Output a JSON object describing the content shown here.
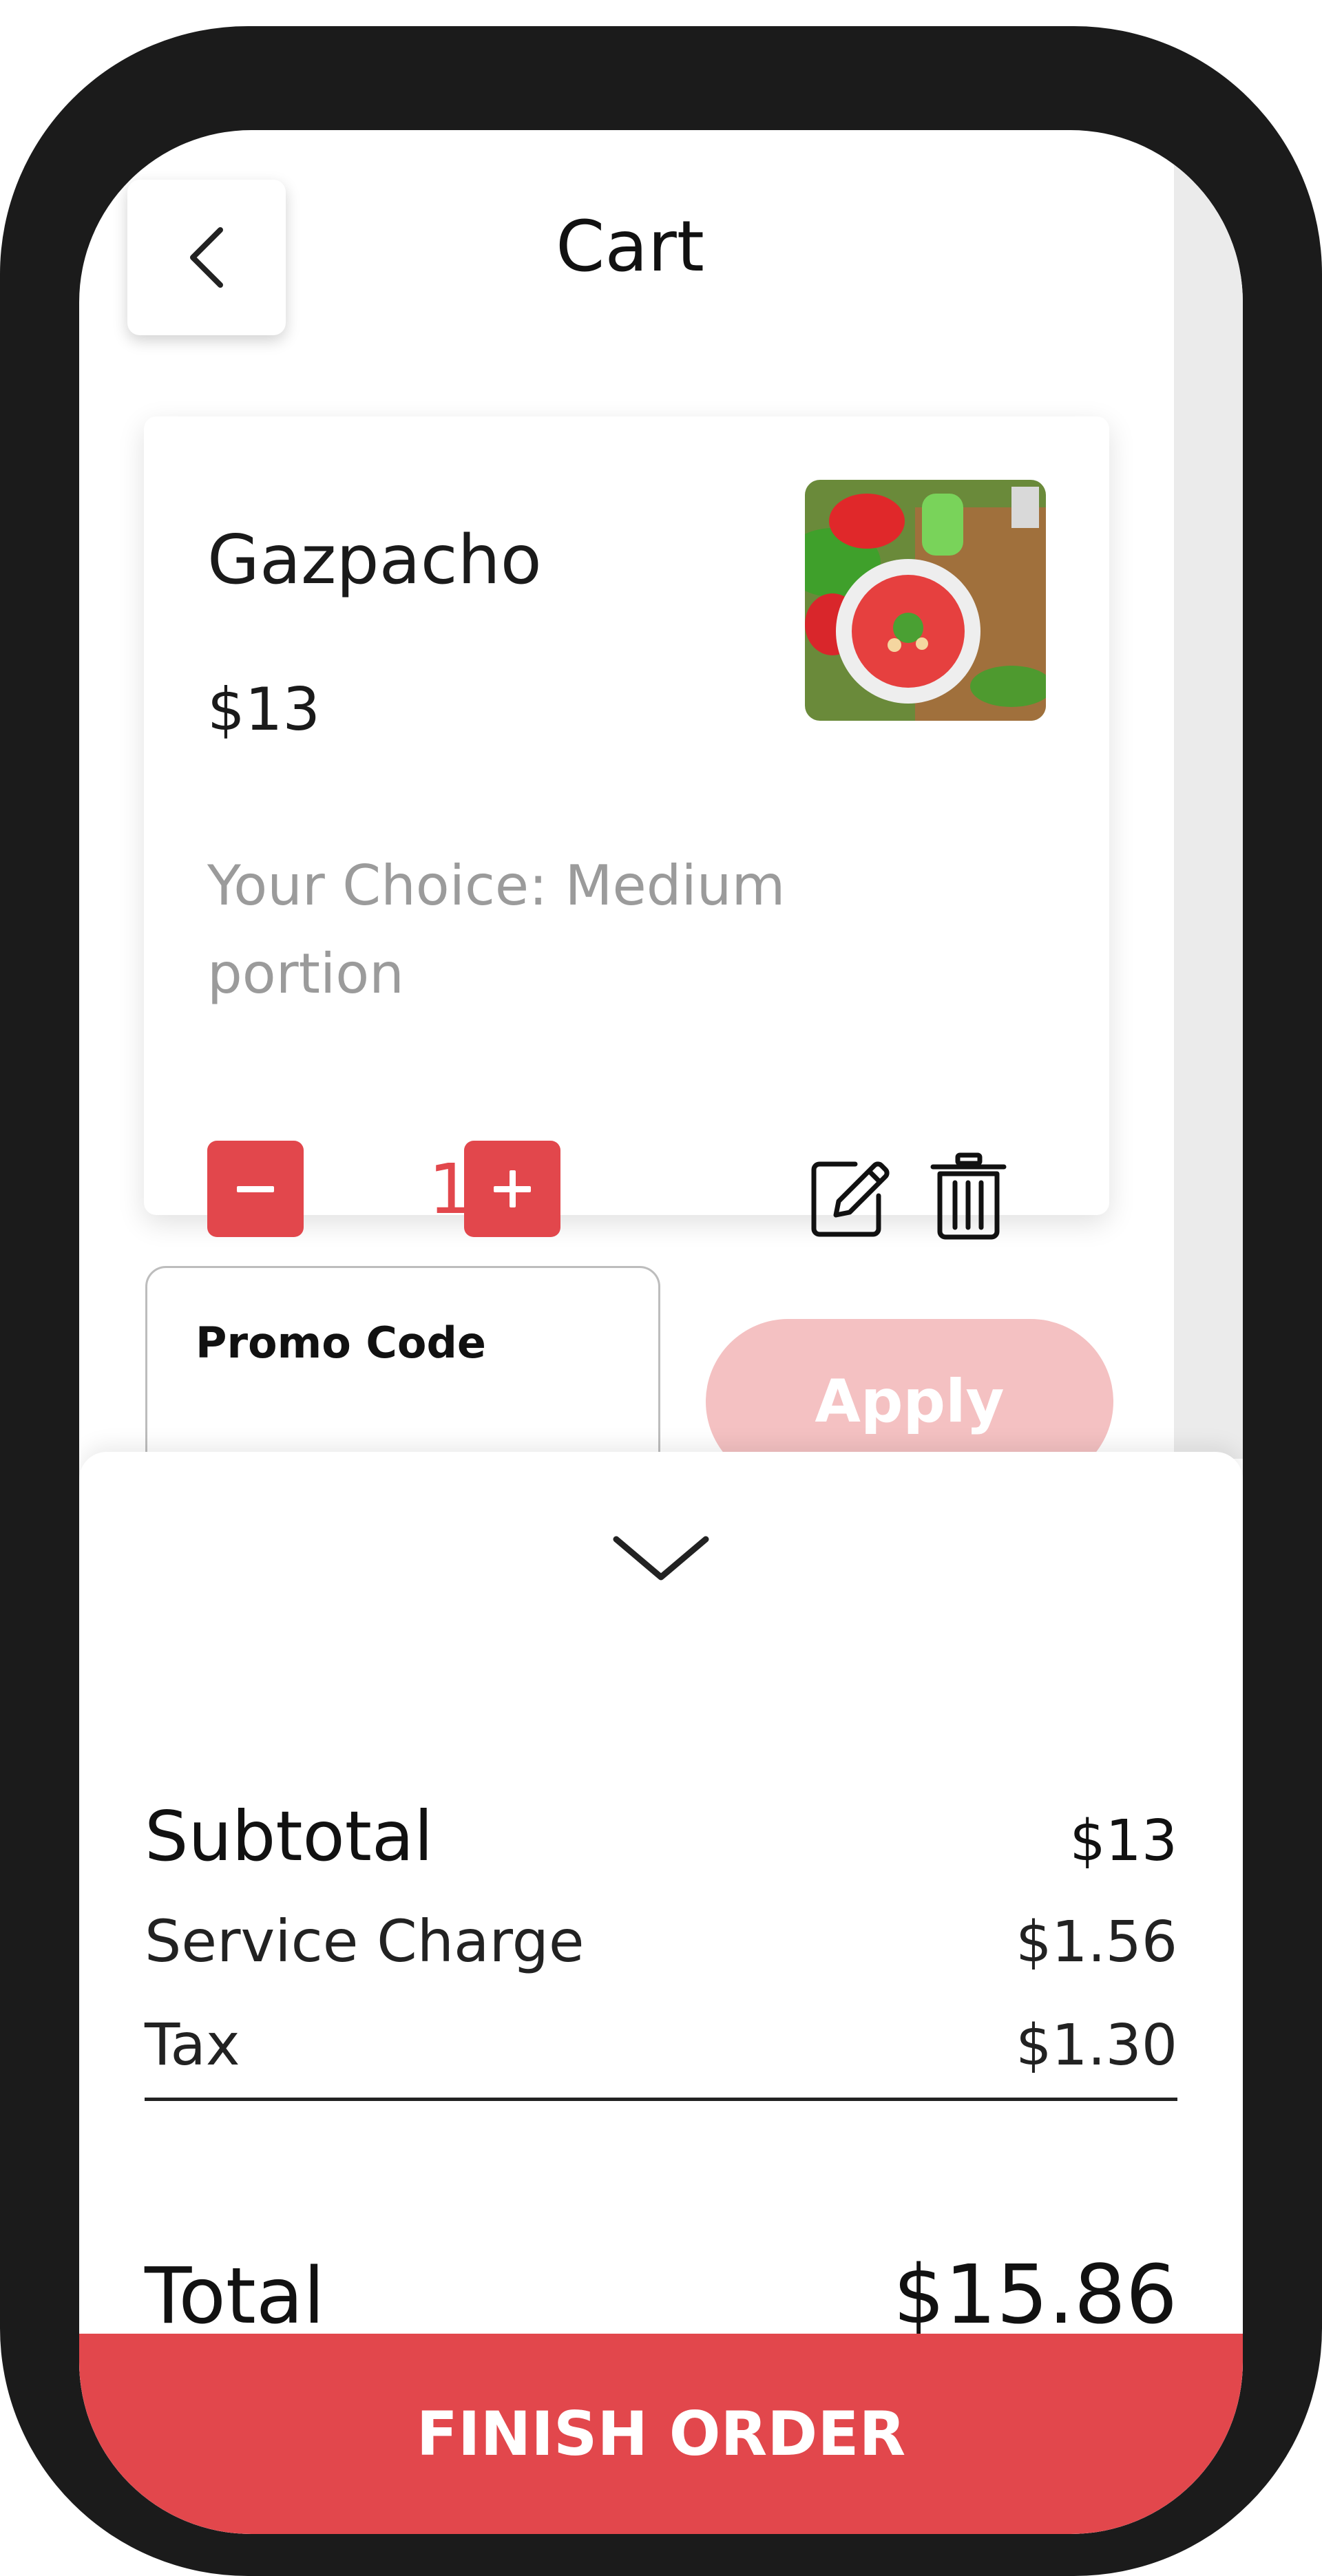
{
  "header": {
    "title": "Cart"
  },
  "icons": {
    "back": "chevron-left-icon",
    "edit": "edit-icon",
    "delete": "trash-icon",
    "collapse": "chevron-down-icon"
  },
  "item": {
    "name": "Gazpacho",
    "price": "$13",
    "choice": "Your Choice: Medium portion",
    "quantity": "1",
    "decrement_symbol": "−",
    "increment_symbol": "+"
  },
  "promo": {
    "label": "Promo Code",
    "value": "",
    "apply_label": "Apply"
  },
  "summary": {
    "subtotal_label": "Subtotal",
    "subtotal_value": "$13",
    "service_label": "Service Charge",
    "service_value": "$1.56",
    "tax_label": "Tax",
    "tax_value": "$1.30",
    "total_label": "Total",
    "total_value": "$15.86"
  },
  "footer": {
    "finish_label": "FINISH ORDER"
  },
  "colors": {
    "accent": "#e2474c",
    "accent_light": "#f4c1c2",
    "frame": "#1b1b1b"
  }
}
